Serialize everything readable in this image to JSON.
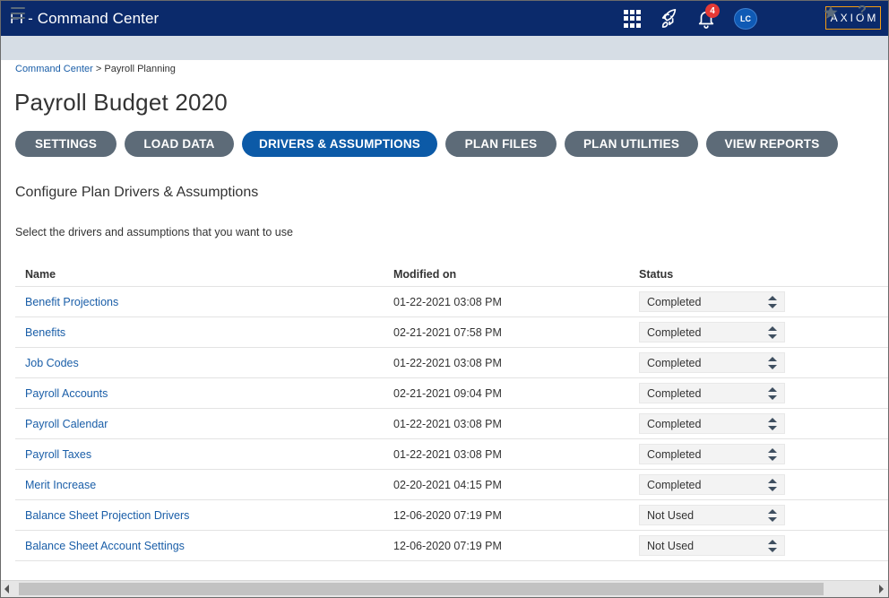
{
  "app": {
    "title": "FI - Command Center",
    "logo": "AXIOM",
    "notifications": "4",
    "user_initials": "LC"
  },
  "icons": {
    "apps": "grid-icon",
    "launch": "rocket-icon",
    "notify": "bell-icon",
    "menu": "hamburger-icon",
    "favorite": "star-icon",
    "help": "help-icon",
    "status_arrows": "sort-arrows-icon"
  },
  "breadcrumb": {
    "root": "Command Center",
    "separator": ">",
    "current": "Payroll Planning"
  },
  "page": {
    "title": "Payroll Budget 2020",
    "section_title": "Configure Plan Drivers & Assumptions",
    "instructions": "Select the drivers and assumptions that you want to use"
  },
  "tabs": [
    {
      "label": "SETTINGS"
    },
    {
      "label": "LOAD DATA"
    },
    {
      "label": "DRIVERS & ASSUMPTIONS",
      "active": true
    },
    {
      "label": "PLAN FILES"
    },
    {
      "label": "PLAN UTILITIES"
    },
    {
      "label": "VIEW REPORTS"
    }
  ],
  "table": {
    "headers": {
      "name": "Name",
      "modified": "Modified on",
      "status": "Status"
    },
    "rows": [
      {
        "name": "Benefit Projections",
        "modified": "01-22-2021 03:08 PM",
        "status": "Completed"
      },
      {
        "name": "Benefits",
        "modified": "02-21-2021 07:58 PM",
        "status": "Completed"
      },
      {
        "name": "Job Codes",
        "modified": "01-22-2021 03:08 PM",
        "status": "Completed"
      },
      {
        "name": "Payroll Accounts",
        "modified": "02-21-2021 09:04 PM",
        "status": "Completed"
      },
      {
        "name": "Payroll Calendar",
        "modified": "01-22-2021 03:08 PM",
        "status": "Completed"
      },
      {
        "name": "Payroll Taxes",
        "modified": "01-22-2021 03:08 PM",
        "status": "Completed"
      },
      {
        "name": "Merit Increase",
        "modified": "02-20-2021 04:15 PM",
        "status": "Completed"
      },
      {
        "name": "Balance Sheet Projection Drivers",
        "modified": "12-06-2020 07:19 PM",
        "status": "Not Used"
      },
      {
        "name": "Balance Sheet Account Settings",
        "modified": "12-06-2020 07:19 PM",
        "status": "Not Used"
      }
    ]
  },
  "colors": {
    "topbar": "#0b2a6b",
    "subbar": "#d6dde5",
    "tab": "#5d6b78",
    "tab_active": "#0c5aa7",
    "link": "#1a5ea8",
    "badge": "#e53935",
    "logo_border": "#f39c12"
  }
}
